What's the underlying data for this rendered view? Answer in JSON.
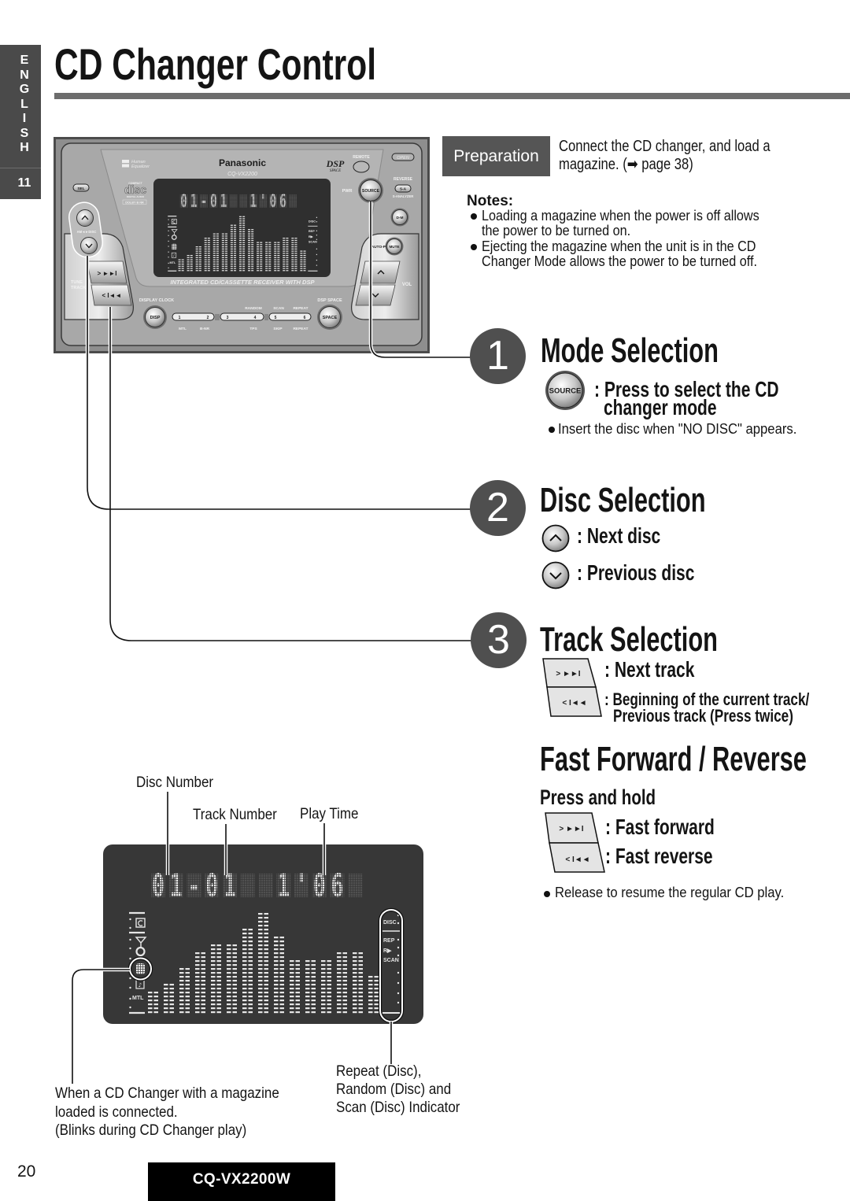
{
  "language_tab": {
    "letters": [
      "E",
      "N",
      "G",
      "L",
      "I",
      "S",
      "H"
    ],
    "section": "11"
  },
  "header": {
    "title": "CD Changer Control"
  },
  "unit_panel": {
    "brand": "Panasonic",
    "model": "CQ-VX2200",
    "human_equalizer": [
      "Human",
      "Equalizer"
    ],
    "cd_logo": {
      "top": "COMPACT",
      "main": "disc",
      "bottom": "DIGITAL AUDIO"
    },
    "dolby": "DOLBY B NR",
    "dsp_logo": {
      "main": "DSP",
      "sub": "SPACE"
    },
    "remote": "REMOTE",
    "open": "OPEN",
    "sel": "SEL",
    "pwr": "PWR",
    "source": "SOURCE",
    "reverse": "REVERSE",
    "sa": "S-A",
    "s_analyzer": "S-ANALYZER",
    "dm": "D-M",
    "auto_p": "AUTO-P",
    "mute": "MUTE",
    "vol": "VOL",
    "tune_track": [
      "TUNE",
      "TRACK"
    ],
    "am_disc": "AM◄►DISC",
    "display_clock": "DISPLAY CLOCK",
    "disp": "DISP",
    "dsp_space": "DSP SPACE",
    "space": "SPACE",
    "presets": [
      "1",
      "2",
      "3",
      "4",
      "5",
      "6"
    ],
    "preset_top": [
      "RANDOM",
      "SCAN",
      "REPEAT"
    ],
    "preset_bottom": [
      "MTL",
      "B-NR",
      "TPS",
      "SKIP",
      "REPEAT"
    ],
    "tagline": "INTEGRATED CD/CASSETTE RECEIVER WITH DSP",
    "next_glyph": "> ►►I",
    "prev_glyph": "< I◄◄"
  },
  "display": {
    "readout": "01-01  1'06",
    "cells": [
      "0",
      "1",
      "-",
      "0",
      "1",
      "",
      "",
      "1",
      "'",
      "0",
      "6",
      ""
    ],
    "spectrum_levels": [
      6,
      8,
      12,
      16,
      18,
      18,
      22,
      26,
      20,
      14,
      14,
      14,
      16,
      16,
      10
    ],
    "mtl_label": "MTL",
    "right_indicators": [
      "DISC",
      "REP",
      "R▶",
      "SCAN"
    ]
  },
  "preparation": {
    "label": "Preparation",
    "lines": [
      "Connect the CD changer, and load a",
      "magazine. (➡ page 38)"
    ]
  },
  "notes": {
    "heading": "Notes:",
    "items": [
      {
        "lines": [
          "Loading a magazine when the power is off allows",
          "the power to be turned on."
        ]
      },
      {
        "lines": [
          "Ejecting the magazine when the unit is in the CD",
          "Changer Mode allows the power to be turned off."
        ]
      }
    ]
  },
  "steps": [
    {
      "number": "1",
      "title": "Mode Selection",
      "button_label": "SOURCE",
      "lines": [
        ": Press to select the CD",
        "changer mode"
      ],
      "note": "Insert the disc when \"NO DISC\" appears."
    },
    {
      "number": "2",
      "title": "Disc Selection",
      "controls": [
        ": Next disc",
        ": Previous disc"
      ]
    },
    {
      "number": "3",
      "title": "Track Selection",
      "next_glyph": "> ►►I",
      "prev_glyph": "< I◄◄",
      "next_text": ": Next track",
      "prev_lines": [
        ": Beginning of the current track/",
        "Previous track (Press twice)"
      ]
    }
  ],
  "fast_forward": {
    "title": "Fast Forward / Reverse",
    "subtitle": "Press and hold",
    "next_glyph": "> ►►I",
    "prev_glyph": "< I◄◄",
    "forward_text": ": Fast forward",
    "reverse_text": ": Fast reverse",
    "note": "Release to resume the regular CD play."
  },
  "display_callouts": {
    "disc_number": "Disc Number",
    "track_number": "Track Number",
    "play_time": "Play Time",
    "changer_indicator": [
      "When a CD Changer with a magazine",
      "loaded is connected.",
      "(Blinks during CD Changer play)"
    ],
    "mode_indicator": [
      "Repeat (Disc),",
      "Random (Disc) and",
      "Scan (Disc) Indicator"
    ]
  },
  "footer": {
    "page_number": "20",
    "model": "CQ-VX2200W"
  }
}
